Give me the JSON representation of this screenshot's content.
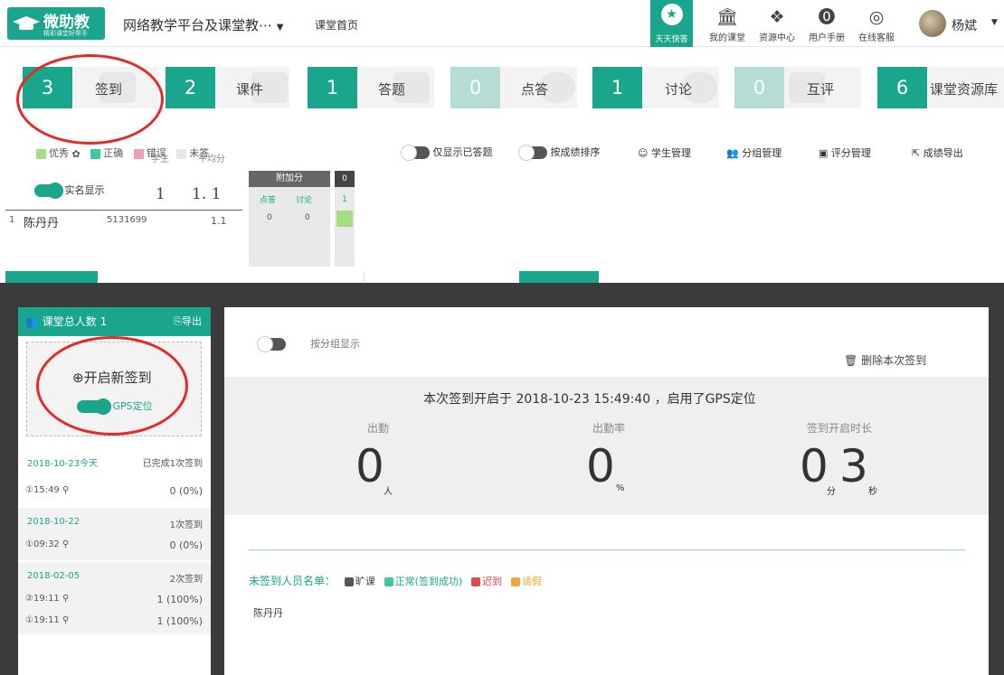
{
  "header": {
    "logo_name": "微助教",
    "logo_slogan": "精彩课堂好帮手",
    "course_title": "网络教学平台及课堂教⋯",
    "home_link": "课堂首页",
    "quick_label": "天天快答",
    "nav": [
      {
        "label": "我的课堂",
        "icon": "bank-icon"
      },
      {
        "label": "资源中心",
        "icon": "cubes-icon"
      },
      {
        "label": "用户手册",
        "icon": "question-icon"
      },
      {
        "label": "在线客服",
        "icon": "chat-icon"
      }
    ],
    "user_name": "杨斌"
  },
  "stats": [
    {
      "num": "3",
      "label": "签到"
    },
    {
      "num": "2",
      "label": "课件"
    },
    {
      "num": "1",
      "label": "答题"
    },
    {
      "num": "0",
      "label": "点答"
    },
    {
      "num": "1",
      "label": "讨论"
    },
    {
      "num": "0",
      "label": "互评"
    },
    {
      "num": "6",
      "label": "课堂资源库"
    }
  ],
  "legend": {
    "excellent": "优秀",
    "correct": "正确",
    "wrong": "错误",
    "unanswered": "未答"
  },
  "options": {
    "only_answered": "仅显示已答题",
    "sort_by_score": "按成绩排序"
  },
  "management": {
    "students": "学生管理",
    "groups": "分组管理",
    "grading": "评分管理",
    "export": "成绩导出"
  },
  "score_table": {
    "realname_label": "实名显示",
    "students_header": "学生",
    "avg_header": "平均分",
    "students_value": "1",
    "avg_value": "1. 1",
    "bonus_header": "附加分",
    "bonus_cols": [
      "点答",
      "讨论"
    ],
    "extra_col_header": "0",
    "extra_col_value": "1",
    "rows": [
      {
        "index": "1",
        "name": "陈丹丹",
        "id": "5131699",
        "avg": "1.1",
        "bonus1": "0",
        "bonus2": "0"
      }
    ]
  },
  "checkin_sidebar": {
    "total_label": "课堂总人数 1",
    "export_label": "导出",
    "new_checkin": "开启新签到",
    "gps_label": "GPS定位",
    "sessions": [
      {
        "date": "2018-10-23今天",
        "count": "已完成1次签到",
        "items": [
          {
            "no": "1",
            "time": "15:49",
            "result": "0 (0%)"
          }
        ]
      },
      {
        "date": "2018-10-22",
        "count": "1次签到",
        "items": [
          {
            "no": "1",
            "time": "09:32",
            "result": "0 (0%)"
          }
        ]
      },
      {
        "date": "2018-02-05",
        "count": "2次签到",
        "items": [
          {
            "no": "2",
            "time": "19:11",
            "result": "1 (100%)"
          },
          {
            "no": "1",
            "time": "19:11",
            "result": "1 (100%)"
          }
        ]
      }
    ]
  },
  "checkin_detail": {
    "group_toggle_label": "按分组显示",
    "delete_label": "删除本次签到",
    "info": "本次签到开启于 2018-10-23 15:49:40 ，启用了GPS定位",
    "attendance_label": "出勤",
    "attendance_value": "0",
    "attendance_unit": "人",
    "rate_label": "出勤率",
    "rate_value": "0",
    "rate_unit": "%",
    "duration_label": "签到开启时长",
    "duration_min": "0",
    "duration_min_unit": "分",
    "duration_sec": "3",
    "duration_sec_unit": "秒",
    "absent_title": "未签到人员名单：",
    "absent_legend": [
      "旷课",
      "正常(签到成功)",
      "迟到",
      "请假"
    ],
    "absent_names": [
      "陈丹丹"
    ]
  },
  "colors": {
    "accent": "#1aa58d",
    "excellent": "#a6dc84",
    "correct": "#3cc8a5",
    "wrong": "#f2a0b1",
    "unanswered": "#e8e8e8",
    "late": "#e04a4a",
    "leave": "#f2a53a",
    "absent": "#555555",
    "annotation": "#e32b2b"
  }
}
